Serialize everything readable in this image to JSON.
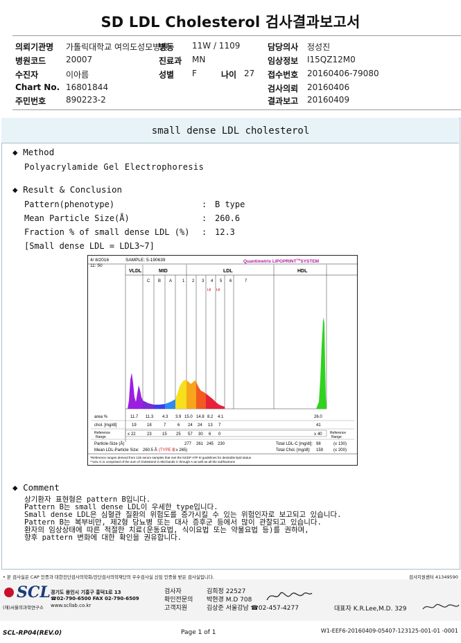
{
  "header": {
    "title": "SD LDL Cholesterol 검사결과보고서",
    "rows": [
      [
        {
          "label": "의뢰기관명",
          "value": "가톨릭대학교 여의도성모병원"
        },
        {
          "label": "병동",
          "value": "11W / 1109"
        },
        {
          "label": "담당의사",
          "value": "정성진"
        }
      ],
      [
        {
          "label": "병원코드",
          "value": "20007"
        },
        {
          "label": "진료과",
          "value": "MN"
        },
        {
          "label": "임상정보",
          "value": "I15QZ12M0"
        }
      ],
      [
        {
          "label": "수진자",
          "value": "이아름"
        },
        {
          "label": "성별",
          "value": "F"
        },
        {
          "label": "나이",
          "value": "27"
        },
        {
          "label": "접수번호",
          "value": "20160406-79080"
        }
      ],
      [
        {
          "label": "Chart No.",
          "value": "16801844"
        },
        {
          "label": "검사의뢰",
          "value": "20160406"
        }
      ],
      [
        {
          "label": "주민번호",
          "value": "890223-2"
        },
        {
          "label": "결과보고",
          "value": "20160409"
        }
      ]
    ]
  },
  "report": {
    "section_title": "small dense LDL cholesterol",
    "method_heading": "Method",
    "method_text": "Polyacrylamide Gel Electrophoresis",
    "result_heading": "Result & Conclusion",
    "results": [
      {
        "label": "Pattern(phenotype)",
        "value": "B type"
      },
      {
        "label": "Mean Particle Size(Å)",
        "value": "260.6"
      },
      {
        "label": "Fraction % of small dense LDL (%)",
        "value": "12.3"
      }
    ],
    "bracket_note": "[Small dense LDL = LDL3~7]",
    "comment_heading": "Comment",
    "comment_lines": [
      "상기환자 표현형은 pattern B입니다.",
      "Pattern B는 small dense LDL이 우세한 type입니다.",
      "Small dense LDL은 심혈관 질환의 위험도를 증가시킬 수 있는 위험인자로 보고되고 있습니다.",
      "Pattern B는 복부비만, 제2형 당뇨병 또는 대사 증후군 등에서 많이 관찰되고 있습니다.",
      "환자의 임상상태에 따른 적절한 치료(운동요법, 식이요법 또는 약물요법 등)를 권하며,",
      "향후 pattern 변화에 대한 확인을 권유합니다."
    ]
  },
  "lipoprint": {
    "date": "4/ 8/2016",
    "time": "11: 50",
    "sample_label": "SAMPLE:  5-190639",
    "brand_prefix": "Quantimetrix ",
    "brand_name": "LIPOPRINT",
    "brand_tm": "TM",
    "brand_suffix": "SYSTEM",
    "group_labels": [
      "VLDL",
      "MID",
      "LDL",
      "HDL"
    ],
    "band_labels": [
      "C",
      "B",
      "A",
      "1",
      "2",
      "3",
      "4",
      "5",
      "6",
      "7"
    ],
    "hi_marks": [
      "HI",
      "HI"
    ],
    "row_area_label": "area %",
    "area_values": [
      "11.7",
      "11.3",
      "4.3",
      "3.9",
      "15.0",
      "14.8",
      "8.2",
      "4.1",
      "26.0"
    ],
    "row_chol_label": "chol. [mg/dl]",
    "chol_values": [
      "19",
      "18",
      "7",
      "6",
      "24",
      "24",
      "13",
      "7",
      "41"
    ],
    "row_ref_label": "Reference\nRange",
    "ref_values": [
      "≤ 22",
      "23",
      "15",
      "25",
      "57",
      "30",
      "6",
      "0",
      "≥ 40"
    ],
    "row_size_label": "Particle-Size (Å)",
    "size_values": [
      "277",
      "261",
      "245",
      "230"
    ],
    "mean_size_label": "Mean LDL-Particle Size:",
    "mean_size_value": "260.5 Å",
    "mean_size_type": "(TYPE B",
    "mean_size_ref": "; ≥ 265)",
    "total_ldlc_label": "Total LDL-C [mg/dl]:",
    "total_ldlc_value": "98",
    "total_ldlc_ref": "(≤ 130)",
    "total_chol_label": "Total Chol. [mg/dl]:",
    "total_chol_value": "159",
    "total_chol_ref": "(≤ 200)",
    "footnote_1": "*Reference ranges derived from 125 serum samples that met the NCEP ATP III guidelines for desirable lipid status",
    "footnote_2": "**LDL-C is comprised of the sum of cholesterol in Mid bands C through A as well as all the subfractions"
  },
  "footer": {
    "notice": "• 본 검사실은 CAP 인증과 대한진단검사의학회/진단검사의학재단의 우수검사실 신임 인증을 받은 검사실입니다.",
    "notice_right": "검사지원센터 41349590",
    "logo_text": "SCL",
    "logo_sub": "(재)서울의과학연구소",
    "address": "경기도 용인시 기흥구 흥덕1로 13",
    "tel_fax": "☎02-790-6500  FAX 02-790-6509",
    "web": "www.scllab.co.kr",
    "staff_roles": [
      "검사자",
      "확인전문의",
      "고객지원"
    ],
    "staff_names": [
      "김희정 22527",
      "박현경 M.D 708",
      "김상준 서울강남 ☎02-457-4277"
    ],
    "director": "대표자 K.R.Lee,M.D. 329",
    "form_id": "SCL-RP04(REV.0)",
    "page_label": "Page 1 of 1",
    "doc_code": "W1-EEF6-20160409-05407-123125-001-01 -0001"
  },
  "colors": {
    "vldl": "#9b1fe0",
    "mid_c": "#7a2ad6",
    "mid_b": "#3b3ff0",
    "mid_a": "#2f8af0",
    "ldl1": "#f6e01d",
    "ldl2": "#f7a51b",
    "ldl3": "#f25a1f",
    "ldl4": "#e8203a",
    "hdl": "#2fd21f",
    "box_border": "#a9bdc9",
    "box_head": "#e8f3f8",
    "logo_red": "#c8102e"
  }
}
